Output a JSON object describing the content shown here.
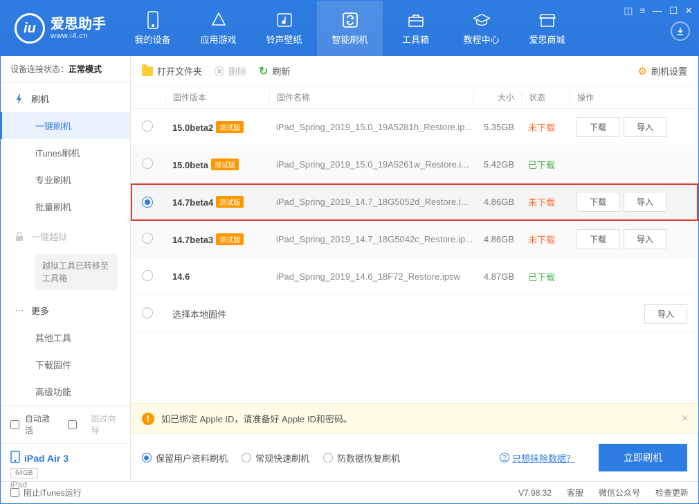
{
  "header": {
    "brand_cn": "爱思助手",
    "brand_en": "www.i4.cn",
    "nav": [
      {
        "label": "我的设备"
      },
      {
        "label": "应用游戏"
      },
      {
        "label": "铃声壁纸"
      },
      {
        "label": "智能刷机"
      },
      {
        "label": "工具箱"
      },
      {
        "label": "教程中心"
      },
      {
        "label": "爱思商城"
      }
    ]
  },
  "sidebar": {
    "status_label": "设备连接状态：",
    "status_value": "正常模式",
    "section1": {
      "header": "刷机",
      "items": [
        "一键刷机",
        "iTunes刷机",
        "专业刷机",
        "批量刷机"
      ]
    },
    "section2": {
      "header": "一键越狱",
      "notice": "越狱工具已转移至工具箱"
    },
    "section3": {
      "header": "更多",
      "items": [
        "其他工具",
        "下载固件",
        "高级功能"
      ]
    },
    "bottom": {
      "auto_activate": "自动激活",
      "skip_guide": "跳过向导"
    },
    "device": {
      "name": "iPad Air 3",
      "storage": "64GB",
      "type": "iPad"
    }
  },
  "toolbar": {
    "open": "打开文件夹",
    "delete": "删除",
    "refresh": "刷新",
    "settings": "刷机设置"
  },
  "table": {
    "headers": {
      "version": "固件版本",
      "name": "固件名称",
      "size": "大小",
      "status": "状态",
      "action": "操作"
    },
    "badge_beta": "测试版",
    "btn_download": "下载",
    "btn_import": "导入",
    "status_no": "未下载",
    "status_yes": "已下载",
    "rows": [
      {
        "version": "15.0beta2",
        "beta": true,
        "name": "iPad_Spring_2019_15.0_19A5281h_Restore.ip...",
        "size": "5.35GB",
        "downloaded": false,
        "selected": false,
        "buttons": true
      },
      {
        "version": "15.0beta",
        "beta": true,
        "name": "iPad_Spring_2019_15.0_19A5261w_Restore.i...",
        "size": "5.42GB",
        "downloaded": true,
        "selected": false,
        "buttons": false
      },
      {
        "version": "14.7beta4",
        "beta": true,
        "name": "iPad_Spring_2019_14.7_18G5052d_Restore.i...",
        "size": "4.86GB",
        "downloaded": false,
        "selected": true,
        "buttons": true,
        "highlighted": true
      },
      {
        "version": "14.7beta3",
        "beta": true,
        "name": "iPad_Spring_2019_14.7_18G5042c_Restore.ip...",
        "size": "4.86GB",
        "downloaded": false,
        "selected": false,
        "buttons": true
      },
      {
        "version": "14.6",
        "beta": false,
        "name": "iPad_Spring_2019_14.6_18F72_Restore.ipsw",
        "size": "4.87GB",
        "downloaded": true,
        "selected": false,
        "buttons": false
      }
    ],
    "local_row": "选择本地固件"
  },
  "warn": "如已绑定 Apple ID，请准备好 Apple ID和密码。",
  "actions": {
    "opts": [
      "保留用户资料刷机",
      "常规快速刷机",
      "防数据恢复刷机"
    ],
    "link": "只想抹除数据？",
    "primary": "立即刷机"
  },
  "footer": {
    "block_itunes": "阻止iTunes运行",
    "version": "V7.98.32",
    "service": "客服",
    "wechat": "微信公众号",
    "update": "检查更新"
  }
}
